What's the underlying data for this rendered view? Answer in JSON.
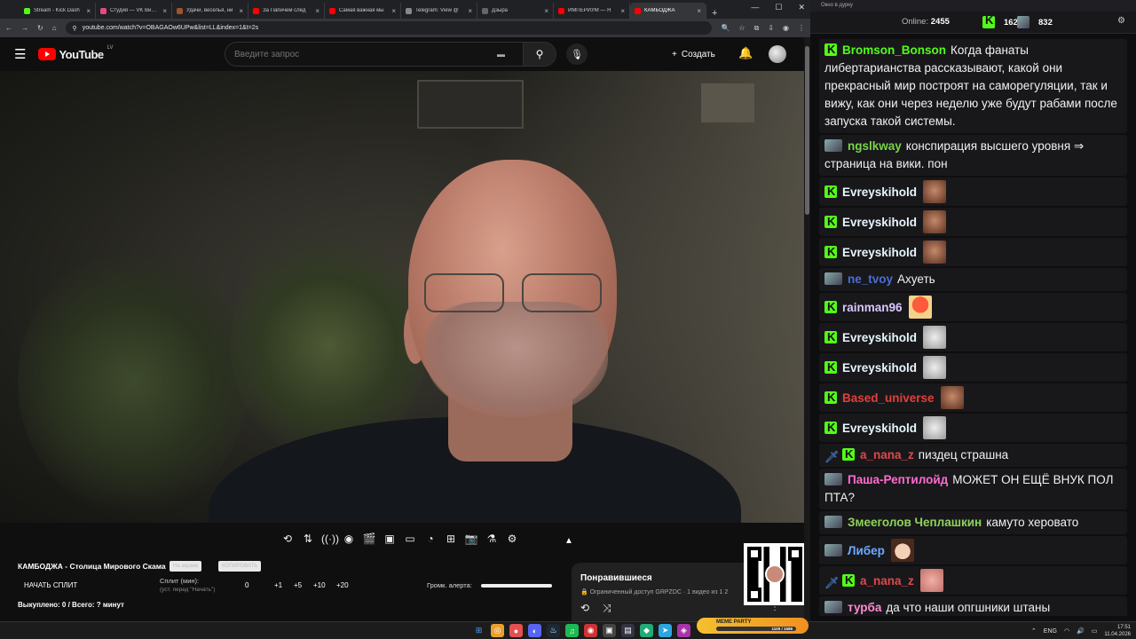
{
  "browser": {
    "tabs": [
      {
        "title": "Stream - Kick Dash",
        "color": "#53fc18"
      },
      {
        "title": "Студия — VK Видео",
        "color": "#e64980"
      },
      {
        "title": "Удачи, веселья, ни",
        "color": "#a0522d"
      },
      {
        "title": "За Папичем след",
        "color": "#ff0000"
      },
      {
        "title": "Самая важная мы",
        "color": "#ff0000"
      },
      {
        "title": "Telegram: View @",
        "color": "#888888"
      },
      {
        "title": "Дзыра",
        "color": "#666666"
      },
      {
        "title": "ИМПЕРИУМ — H",
        "color": "#ff0000"
      },
      {
        "title": "КАМБОДЖА",
        "color": "#ff0000"
      }
    ],
    "new_tab": "+",
    "url": "youtube.com/watch?v=OBAGAOw6UPw&list=LL&index=1&t=2s"
  },
  "youtube": {
    "logo_text": "YouTube",
    "region": "LV",
    "search_placeholder": "Введите запрос",
    "create_label": "Создать"
  },
  "panel": {
    "title": "КАМБОДЖА - Столица Мирового Скама",
    "pill1": "На экране",
    "pill2": "КОПИРОВАТЬ",
    "split_button": "НАЧАТЬ СПЛИТ",
    "split_label": "Сплит (мин):",
    "split_hint": "(уст. перед \"Начать\")",
    "split_value": "0",
    "steps": [
      "+1",
      "+5",
      "+10",
      "+20"
    ],
    "alert_label": "Громк. алерта:",
    "bought": "Выкуплено: 0 / Всего: ? минут"
  },
  "liked": {
    "title": "Понравившиеся",
    "subtitle": "🔒 Ограниченный доступ  GRPZDC · 1 видео из 1 2"
  },
  "chat": {
    "window_title": "Окно в дурку",
    "online_label": "Online:",
    "online": "2455",
    "count1": "1623",
    "count2": "832",
    "messages": [
      {
        "user": "Bromson_Bonson",
        "color": "#53fc18",
        "badge": "kick",
        "text": "Когда фанаты либертарианства рассказывают, какой они прекрасный мир построят на саморегуляции, так и вижу, как они через неделю уже будут рабами после запуска такой системы."
      },
      {
        "user": "ngslkway",
        "color": "#7bd44a",
        "badge": "avatar",
        "text": "конспирация высшего уровня ⇒ страница на вики. пон"
      },
      {
        "user": "Evreyskihold",
        "color": "#e8f6ff",
        "badge": "kick",
        "text": "",
        "emote": "face"
      },
      {
        "user": "Evreyskihold",
        "color": "#e8f6ff",
        "badge": "kick",
        "text": "",
        "emote": "face"
      },
      {
        "user": "Evreyskihold",
        "color": "#e8f6ff",
        "badge": "kick",
        "text": "",
        "emote": "face"
      },
      {
        "user": "ne_tvoy",
        "color": "#4a6fd4",
        "badge": "avatar",
        "text": "Ахуеть"
      },
      {
        "user": "rainman96",
        "color": "#d8c8ff",
        "badge": "kick",
        "text": "",
        "emote": "mush"
      },
      {
        "user": "Evreyskihold",
        "color": "#e8f6ff",
        "badge": "kick",
        "text": "",
        "emote": "cat"
      },
      {
        "user": "Evreyskihold",
        "color": "#e8f6ff",
        "badge": "kick",
        "text": "",
        "emote": "cat"
      },
      {
        "user": "Based_universe",
        "color": "#e0403a",
        "badge": "kick",
        "text": "",
        "emote": "face"
      },
      {
        "user": "Evreyskihold",
        "color": "#e8f6ff",
        "badge": "kick",
        "text": "",
        "emote": "cat"
      },
      {
        "user": "a_nana_z",
        "color": "#e04848",
        "badge": "sword-kick",
        "text": "пиздец страшна"
      },
      {
        "user": "Паша-Рептилойд",
        "color": "#ff6bd0",
        "badge": "avatar",
        "text": "МОЖЕТ ОН ЕЩЁ ВНУК ПОЛ ПТА?"
      },
      {
        "user": "Змееголов Чеплашкин",
        "color": "#8fd45a",
        "badge": "avatar",
        "text": "камуто херовато"
      },
      {
        "user": "Либер",
        "color": "#6fa8ff",
        "badge": "avatar",
        "text": "",
        "emote": "anime"
      },
      {
        "user": "a_nana_z",
        "color": "#e04848",
        "badge": "sword-kick",
        "text": "",
        "emote": "pink"
      },
      {
        "user": "турба",
        "color": "#ff8ad0",
        "badge": "avatar",
        "text": "да что наши опгшники штаны просиживают) камбоджи золотая жила)))"
      }
    ]
  },
  "taskbar": {
    "meme_party": "MEME PARTY",
    "meme_progress": "1100 / 1599",
    "lang": "ENG",
    "time": "17:51",
    "date": "11.04.2026"
  }
}
